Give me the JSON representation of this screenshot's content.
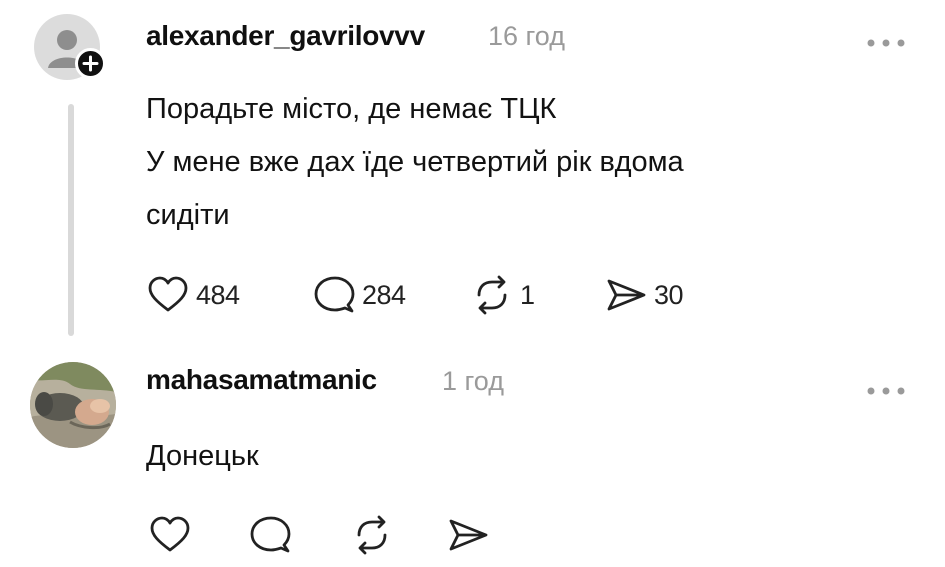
{
  "comments": [
    {
      "username": "alexander_gavrilovvv",
      "time": "16 год",
      "lines": [
        "Порадьте місто, де немає ТЦК",
        "У мене вже дах їде четвертий рік вдома",
        "сидіти"
      ],
      "actions": {
        "likes": "484",
        "replies": "284",
        "reposts": "1",
        "shares": "30"
      },
      "avatar_icon": "default-user-icon",
      "badge_icon": "plus-icon"
    },
    {
      "username": "mahasamatmanic",
      "time": "1 год",
      "lines": [
        "Донецьк"
      ],
      "actions": {
        "likes": "",
        "replies": "",
        "reposts": "",
        "shares": ""
      },
      "avatar_icon": "user-photo"
    }
  ],
  "icons": [
    "heart-icon",
    "comment-icon",
    "repost-icon",
    "share-icon",
    "more-icon"
  ],
  "colors": {
    "text": "#111111",
    "muted": "#9a9a9a",
    "thread_line": "#d9d9d9",
    "background": "#ffffff"
  }
}
